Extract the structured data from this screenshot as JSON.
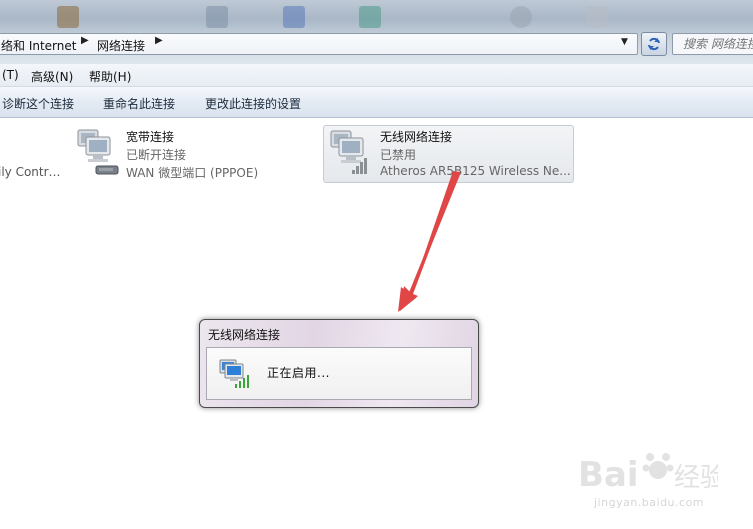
{
  "breadcrumb": {
    "parts": [
      "络和 Internet",
      "网络连接"
    ]
  },
  "search": {
    "placeholder": "搜索 网络连接"
  },
  "menu": {
    "items": [
      "(T)",
      "高级(N)",
      "帮助(H)"
    ]
  },
  "toolbar": {
    "items": [
      "诊断这个连接",
      "重命名此连接",
      "更改此连接的设置"
    ]
  },
  "connections": {
    "partial_label": "ily Contr…",
    "broadband": {
      "title": "宽带连接",
      "status": "已断开连接",
      "device": "WAN 微型端口 (PPPOE)"
    },
    "wireless": {
      "title": "无线网络连接",
      "status": "已禁用",
      "device": "Atheros AR5B125 Wireless Ne..."
    }
  },
  "dialog": {
    "title": "无线网络连接",
    "message": "正在启用..."
  },
  "watermark": {
    "url": "jingyan.baidu.com"
  },
  "colors": {
    "annotation_arrow": "#e04646",
    "signal_green": "#3aa63a"
  }
}
